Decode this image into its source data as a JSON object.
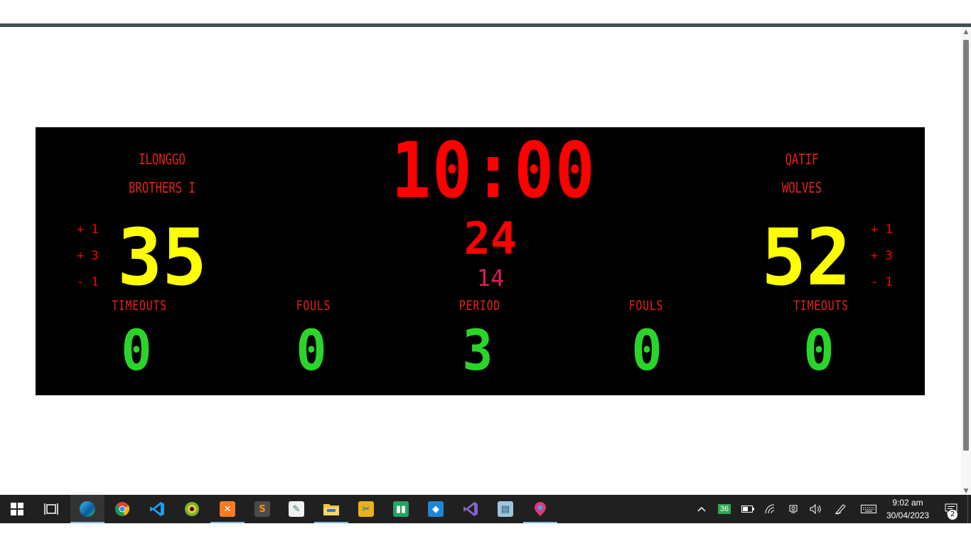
{
  "scoreboard": {
    "home": {
      "name_line1": "ILONGGO",
      "name_line2": "BROTHERS I",
      "score": "35",
      "timeouts": "0",
      "fouls": "0"
    },
    "away": {
      "name_line1": "QATIF",
      "name_line2": "WOLVES",
      "score": "52",
      "timeouts": "0",
      "fouls": "0"
    },
    "game_clock": "10:00",
    "shot_clock": "24",
    "sub_counter": "14",
    "period": "3",
    "labels": {
      "timeouts": "TIMEOUTS",
      "fouls": "FOULS",
      "period": "PERIOD"
    },
    "score_buttons": {
      "plus1": "+ 1",
      "plus3": "+ 3",
      "minus1": "- 1"
    },
    "colors": {
      "board": "#000000",
      "label": "#e4221d",
      "clock": "#ff0000",
      "score": "#ffff00",
      "counter": "#2ad52a",
      "sub_counter": "#e5195a"
    }
  },
  "taskbar": {
    "apps": [
      "start",
      "task-view",
      "edge",
      "chrome",
      "vscode",
      "pycharm",
      "xampp",
      "sublime-text",
      "notepad-plus-plus",
      "snip-sketch",
      "file-explorer",
      "photos",
      "teams-green-app",
      "sandbox",
      "visual-studio",
      "notes",
      "maps"
    ],
    "tray": {
      "battery_badge": "36"
    },
    "time": "9:02 am",
    "date": "30/04/2023",
    "notification_count": "2"
  }
}
